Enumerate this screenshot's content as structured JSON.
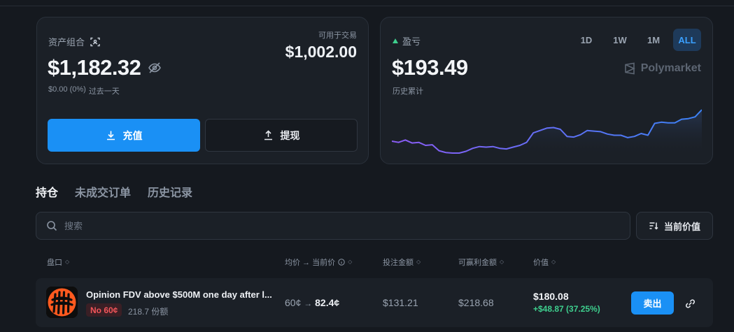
{
  "portfolio": {
    "label": "资产组合",
    "value": "$1,182.32",
    "change": "$0.00 (0%)",
    "change_period": "过去一天",
    "available_label": "可用于交易",
    "available_value": "$1,002.00",
    "deposit_label": "充值",
    "withdraw_label": "提现"
  },
  "pnl": {
    "label": "盈亏",
    "value": "$193.49",
    "sub": "历史累计",
    "brand": "Polymarket",
    "ranges": [
      "1D",
      "1W",
      "1M",
      "ALL"
    ],
    "active_range": "ALL",
    "line_color": "#3b82f6",
    "line_color_secondary": "#8b5cf6",
    "series": [
      0.62,
      0.6,
      0.64,
      0.59,
      0.6,
      0.55,
      0.56,
      0.46,
      0.43,
      0.42,
      0.42,
      0.45,
      0.5,
      0.53,
      0.52,
      0.53,
      0.5,
      0.49,
      0.52,
      0.55,
      0.6,
      0.76,
      0.8,
      0.84,
      0.85,
      0.82,
      0.7,
      0.69,
      0.73,
      0.8,
      0.79,
      0.78,
      0.74,
      0.72,
      0.72,
      0.68,
      0.7,
      0.75,
      0.72,
      0.92,
      0.94,
      0.93,
      0.93,
      0.99,
      1.0,
      1.03,
      1.15
    ]
  },
  "tabs": [
    "持仓",
    "未成交订单",
    "历史记录"
  ],
  "active_tab": "持仓",
  "search": {
    "placeholder": "搜索"
  },
  "sort": {
    "label": "当前价值"
  },
  "table": {
    "columns": {
      "market": "盘口",
      "avg_current": "均价 → 当前价",
      "bet": "投注金额",
      "to_win": "可赢利金额",
      "value": "价值"
    },
    "rows": [
      {
        "title": "Opinion FDV above $500M one day after l...",
        "outcome": "No 60¢",
        "shares": "218.7 份额",
        "avg_price": "60¢",
        "current_price": "82.4¢",
        "bet": "$131.21",
        "to_win": "$218.68",
        "value": "$180.08",
        "value_change": "+$48.87 (37.25%)",
        "sell_label": "卖出"
      }
    ]
  }
}
